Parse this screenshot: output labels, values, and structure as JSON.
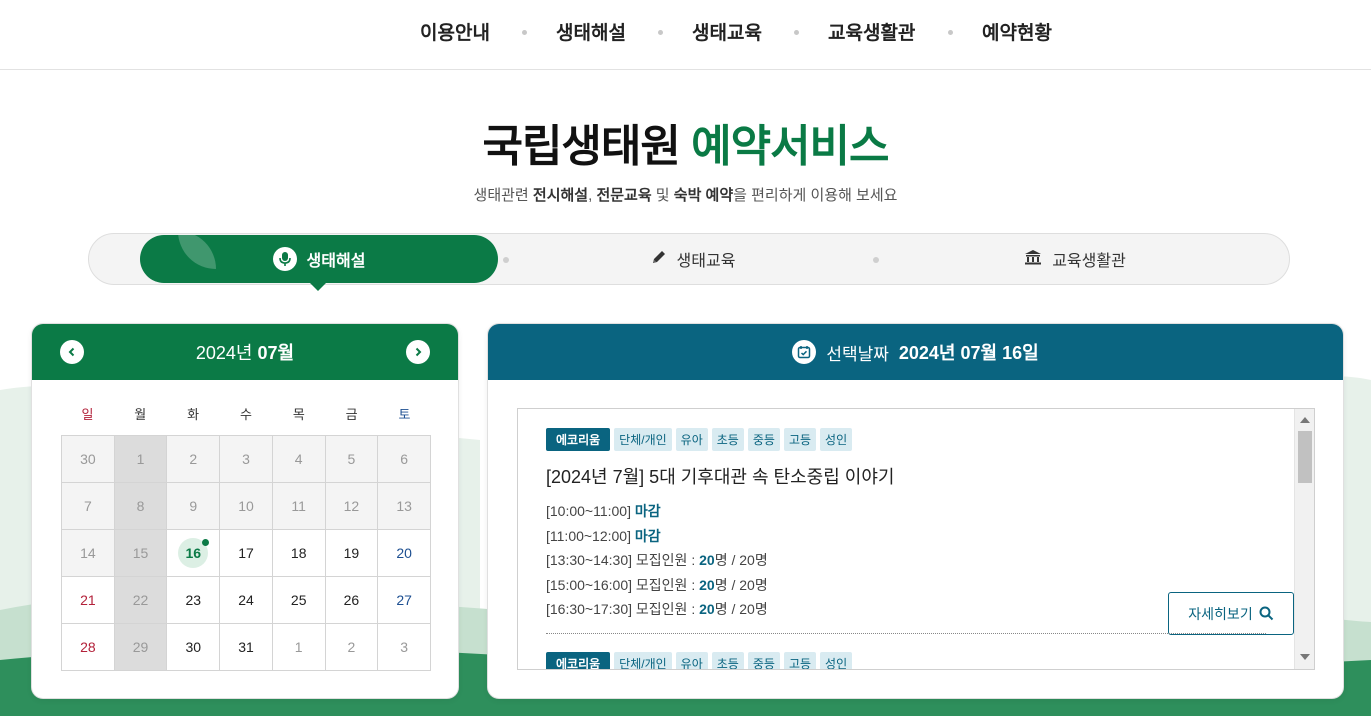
{
  "nav": {
    "items": [
      "이용안내",
      "생태해설",
      "생태교육",
      "교육생활관",
      "예약현황"
    ]
  },
  "hero": {
    "title_main": "국립생태원",
    "title_accent": "예약서비스",
    "subtitle_parts": [
      "생태관련 ",
      "전시해설",
      ", ",
      "전문교육",
      " 및 ",
      "숙박 예약",
      "을 편리하게 이용해 보세요"
    ]
  },
  "tabs": [
    {
      "label": "생태해설",
      "icon": "microphone-icon",
      "active": true
    },
    {
      "label": "생태교육",
      "icon": "pencil-icon",
      "active": false
    },
    {
      "label": "교육생활관",
      "icon": "building-icon",
      "active": false
    }
  ],
  "calendar": {
    "year_label": "2024년",
    "month_label": "07월",
    "weekdays": [
      "일",
      "월",
      "화",
      "수",
      "목",
      "금",
      "토"
    ],
    "weeks": [
      [
        "30",
        "1",
        "2",
        "3",
        "4",
        "5",
        "6"
      ],
      [
        "7",
        "8",
        "9",
        "10",
        "11",
        "12",
        "13"
      ],
      [
        "14",
        "15",
        "16",
        "17",
        "18",
        "19",
        "20"
      ],
      [
        "21",
        "22",
        "23",
        "24",
        "25",
        "26",
        "27"
      ],
      [
        "28",
        "29",
        "30",
        "31",
        "1",
        "2",
        "3"
      ]
    ],
    "selected_day": "16"
  },
  "program": {
    "header_label": "선택날짜",
    "header_date": "2024년 07월 16일",
    "items": [
      {
        "category": "에코리움",
        "targets": [
          "단체/개인",
          "유아",
          "초등",
          "중등",
          "고등",
          "성인"
        ],
        "title": "[2024년 7월] 5대 기후대관 속 탄소중립 이야기",
        "slots": [
          {
            "time": "[10:00~11:00]",
            "status": "마감"
          },
          {
            "time": "[11:00~12:00]",
            "status": "마감"
          },
          {
            "time": "[13:30~14:30]",
            "label": "모집인원 : ",
            "current": "20",
            "rest": "명 / 20명"
          },
          {
            "time": "[15:00~16:00]",
            "label": "모집인원 : ",
            "current": "20",
            "rest": "명 / 20명"
          },
          {
            "time": "[16:30~17:30]",
            "label": "모집인원 : ",
            "current": "20",
            "rest": "명 / 20명"
          }
        ],
        "detail_label": "자세히보기"
      },
      {
        "category": "에코리움",
        "targets": [
          "단체/개인",
          "유아",
          "초등",
          "중등",
          "고등",
          "성인"
        ]
      }
    ]
  },
  "colors": {
    "green": "#0b7a46",
    "teal": "#0a6480"
  }
}
